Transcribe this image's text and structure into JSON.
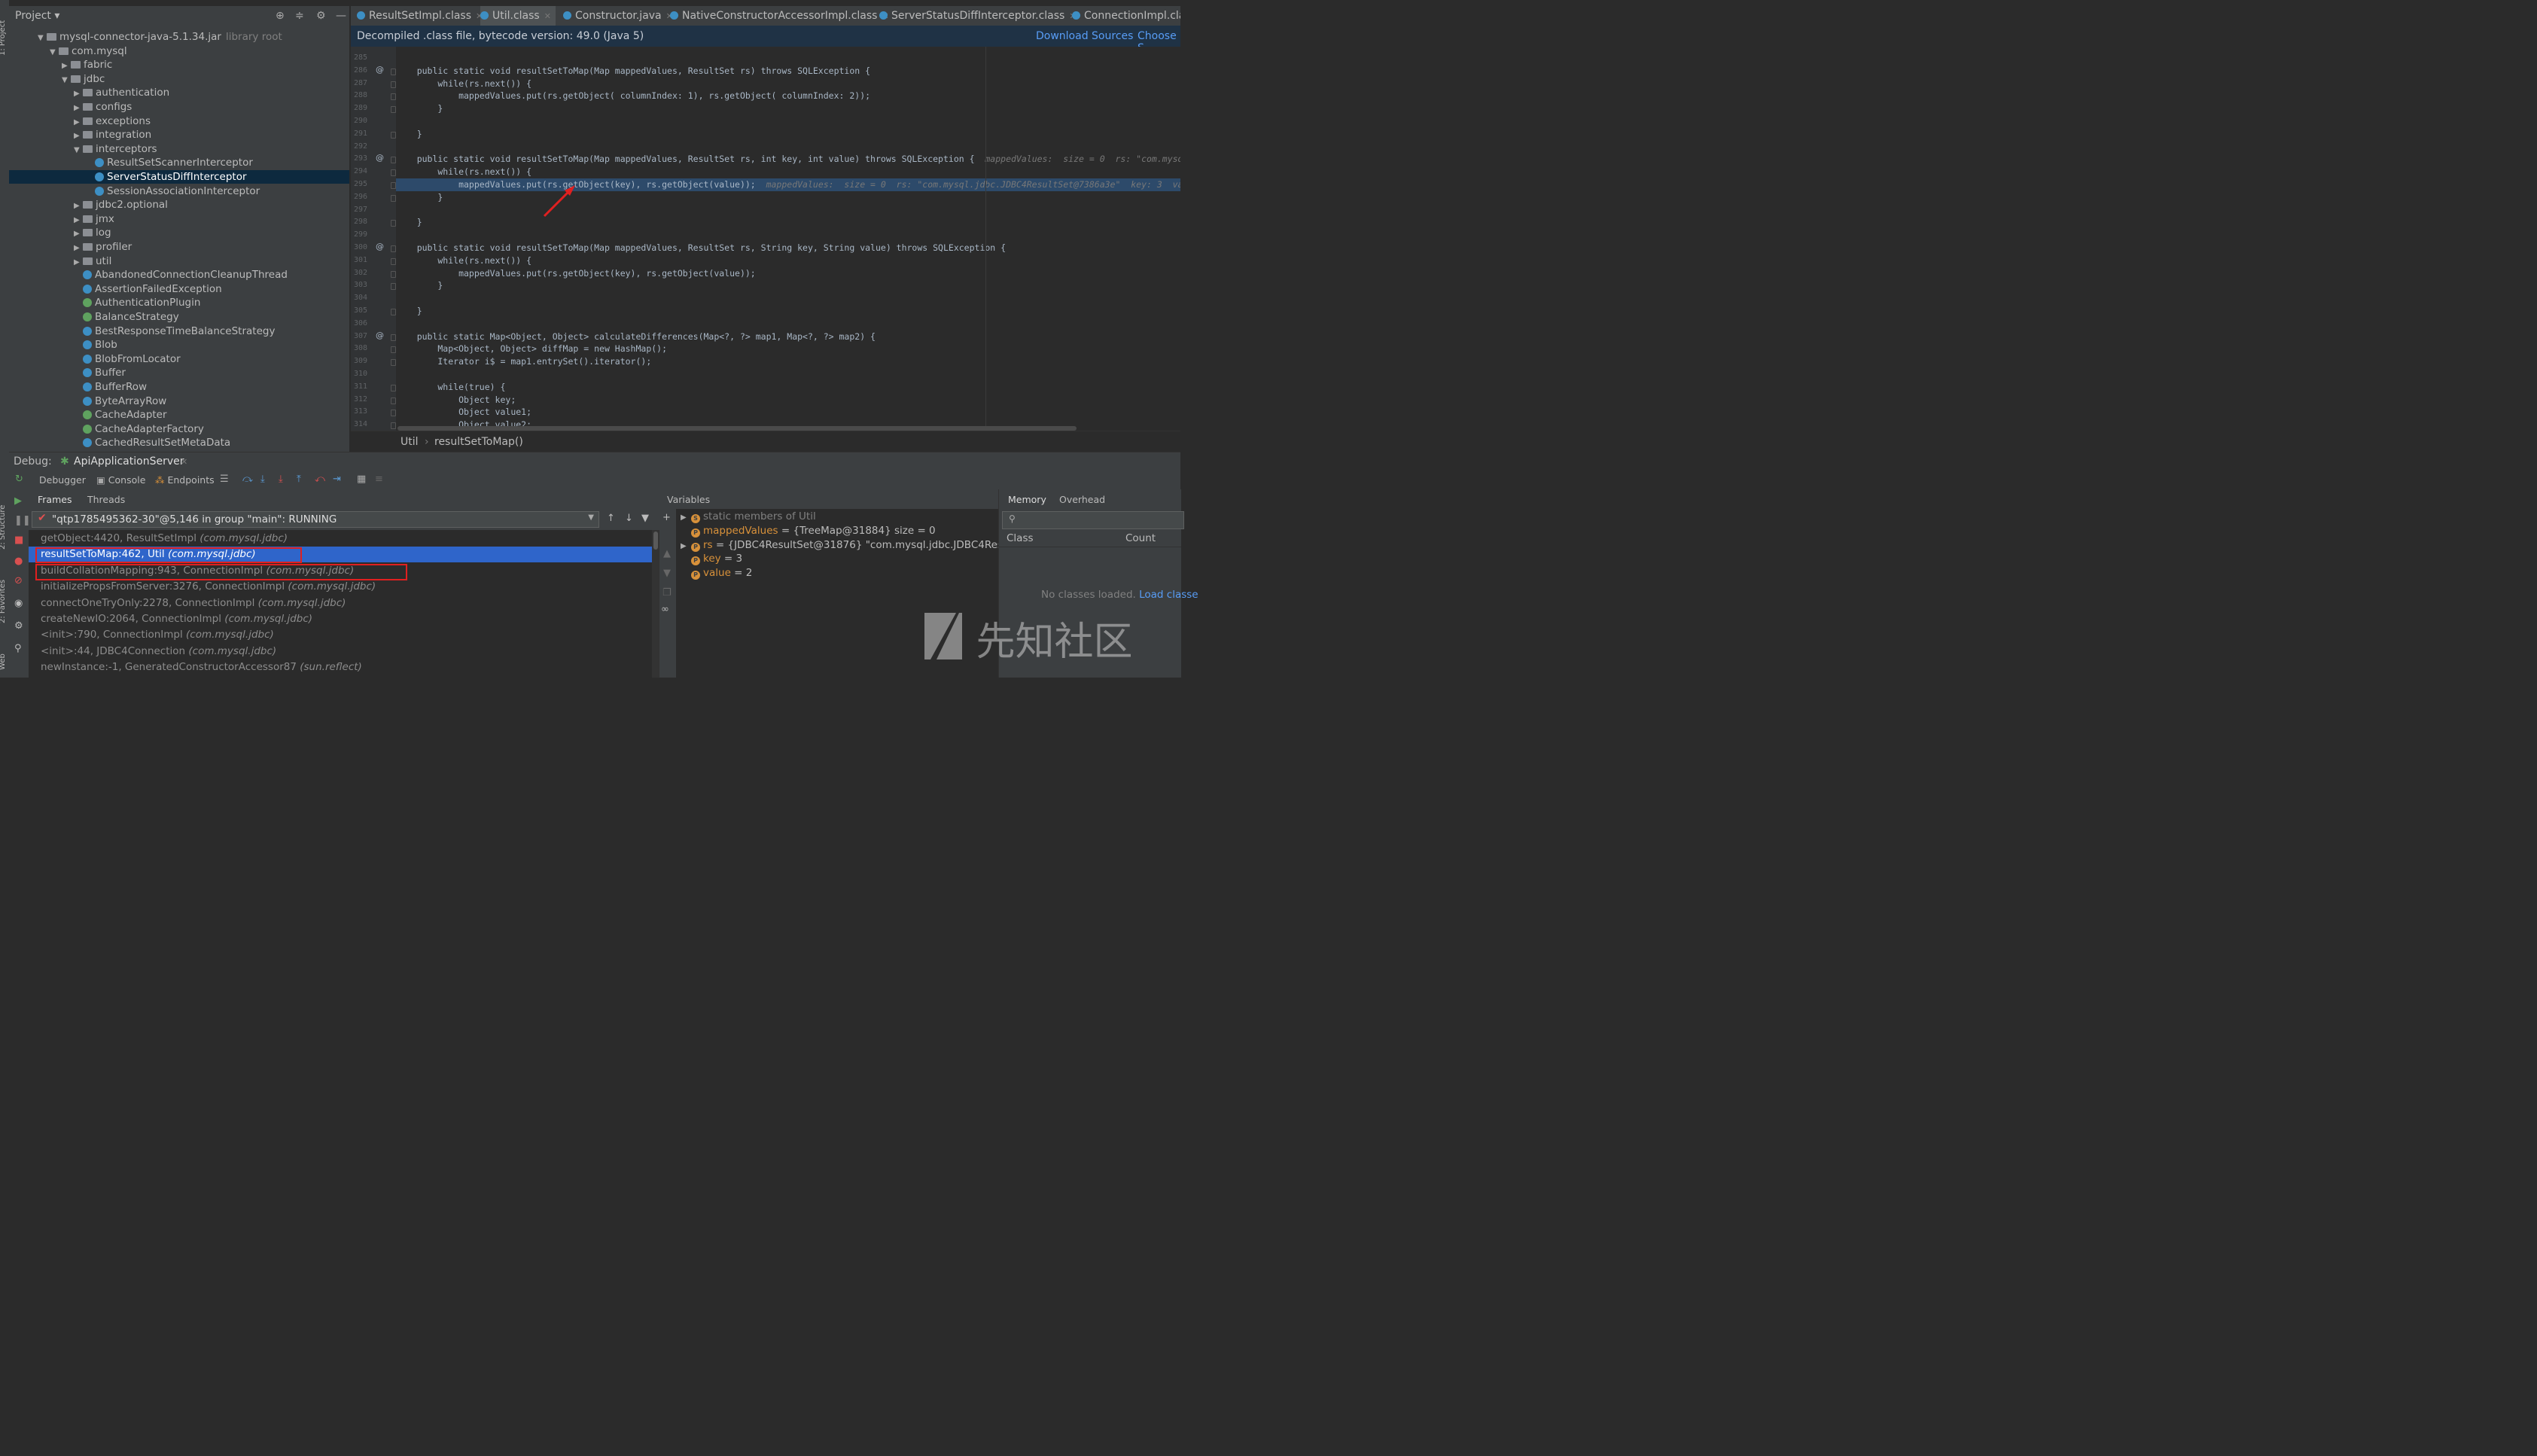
{
  "project_panel": {
    "title": "Project",
    "tree": [
      {
        "label": "mysql-connector-java-5.1.34.jar",
        "note": "library root",
        "indent": 3,
        "kind": "jar",
        "arrow": "▼"
      },
      {
        "label": "com.mysql",
        "indent": 4,
        "kind": "folder",
        "arrow": "▼"
      },
      {
        "label": "fabric",
        "indent": 5,
        "kind": "folder",
        "arrow": "▶"
      },
      {
        "label": "jdbc",
        "indent": 5,
        "kind": "folder",
        "arrow": "▼"
      },
      {
        "label": "authentication",
        "indent": 6,
        "kind": "folder",
        "arrow": "▶"
      },
      {
        "label": "configs",
        "indent": 6,
        "kind": "folder",
        "arrow": "▶"
      },
      {
        "label": "exceptions",
        "indent": 6,
        "kind": "folder",
        "arrow": "▶"
      },
      {
        "label": "integration",
        "indent": 6,
        "kind": "folder",
        "arrow": "▶"
      },
      {
        "label": "interceptors",
        "indent": 6,
        "kind": "folder",
        "arrow": "▼"
      },
      {
        "label": "ResultSetScannerInterceptor",
        "indent": 7,
        "kind": "class"
      },
      {
        "label": "ServerStatusDiffInterceptor",
        "indent": 7,
        "kind": "class",
        "selected": true
      },
      {
        "label": "SessionAssociationInterceptor",
        "indent": 7,
        "kind": "class"
      },
      {
        "label": "jdbc2.optional",
        "indent": 6,
        "kind": "folder",
        "arrow": "▶"
      },
      {
        "label": "jmx",
        "indent": 6,
        "kind": "folder",
        "arrow": "▶"
      },
      {
        "label": "log",
        "indent": 6,
        "kind": "folder",
        "arrow": "▶"
      },
      {
        "label": "profiler",
        "indent": 6,
        "kind": "folder",
        "arrow": "▶"
      },
      {
        "label": "util",
        "indent": 6,
        "kind": "folder",
        "arrow": "▶"
      },
      {
        "label": "AbandonedConnectionCleanupThread",
        "indent": 6,
        "kind": "class"
      },
      {
        "label": "AssertionFailedException",
        "indent": 6,
        "kind": "class"
      },
      {
        "label": "AuthenticationPlugin",
        "indent": 6,
        "kind": "class-green"
      },
      {
        "label": "BalanceStrategy",
        "indent": 6,
        "kind": "class-green"
      },
      {
        "label": "BestResponseTimeBalanceStrategy",
        "indent": 6,
        "kind": "class"
      },
      {
        "label": "Blob",
        "indent": 6,
        "kind": "class"
      },
      {
        "label": "BlobFromLocator",
        "indent": 6,
        "kind": "class"
      },
      {
        "label": "Buffer",
        "indent": 6,
        "kind": "class"
      },
      {
        "label": "BufferRow",
        "indent": 6,
        "kind": "class"
      },
      {
        "label": "ByteArrayRow",
        "indent": 6,
        "kind": "class"
      },
      {
        "label": "CacheAdapter",
        "indent": 6,
        "kind": "class-green"
      },
      {
        "label": "CacheAdapterFactory",
        "indent": 6,
        "kind": "class-green"
      },
      {
        "label": "CachedResultSetMetaData",
        "indent": 6,
        "kind": "class"
      }
    ]
  },
  "editor": {
    "tabs": [
      "ResultSetImpl.class",
      "Util.class",
      "Constructor.java",
      "NativeConstructorAccessorImpl.class",
      "ServerStatusDiffInterceptor.class",
      "ConnectionImpl.cla"
    ],
    "active_tab": "Util.class",
    "info_message": "Decompiled .class file, bytecode version: 49.0 (Java 5)",
    "download_sources": "Download Sources",
    "choose_sources": "Choose S",
    "lines": [
      {
        "n": "285",
        "code": "",
        "at": false
      },
      {
        "n": "286",
        "code": "    public static void resultSetToMap(Map mappedValues, ResultSet rs) throws SQLException {",
        "at": true
      },
      {
        "n": "287",
        "code": "        while(rs.next()) {",
        "at": false
      },
      {
        "n": "288",
        "code": "            mappedValues.put(rs.getObject( columnIndex: 1), rs.getObject( columnIndex: 2));",
        "at": false
      },
      {
        "n": "289",
        "code": "        }",
        "at": false
      },
      {
        "n": "290",
        "code": "",
        "at": false
      },
      {
        "n": "291",
        "code": "    }",
        "at": false
      },
      {
        "n": "292",
        "code": "",
        "at": false
      },
      {
        "n": "293",
        "code": "    public static void resultSetToMap(Map mappedValues, ResultSet rs, int key, int value) throws SQLException {",
        "hint": "  mappedValues:  size = 0  rs: \"com.mysql.jdbc.JD",
        "at": true
      },
      {
        "n": "294",
        "code": "        while(rs.next()) {",
        "at": false
      },
      {
        "n": "295",
        "code": "            mappedValues.put(rs.getObject(key), rs.getObject(value));",
        "hint": "  mappedValues:  size = 0  rs: \"com.mysql.jdbc.JDBC4ResultSet@7386a3e\"  key: 3  value: 2",
        "at": false,
        "highlight": true
      },
      {
        "n": "296",
        "code": "        }",
        "at": false
      },
      {
        "n": "297",
        "code": "",
        "at": false
      },
      {
        "n": "298",
        "code": "    }",
        "at": false
      },
      {
        "n": "299",
        "code": "",
        "at": false
      },
      {
        "n": "300",
        "code": "    public static void resultSetToMap(Map mappedValues, ResultSet rs, String key, String value) throws SQLException {",
        "at": true
      },
      {
        "n": "301",
        "code": "        while(rs.next()) {",
        "at": false
      },
      {
        "n": "302",
        "code": "            mappedValues.put(rs.getObject(key), rs.getObject(value));",
        "at": false
      },
      {
        "n": "303",
        "code": "        }",
        "at": false
      },
      {
        "n": "304",
        "code": "",
        "at": false
      },
      {
        "n": "305",
        "code": "    }",
        "at": false
      },
      {
        "n": "306",
        "code": "",
        "at": false
      },
      {
        "n": "307",
        "code": "    public static Map<Object, Object> calculateDifferences(Map<?, ?> map1, Map<?, ?> map2) {",
        "at": true
      },
      {
        "n": "308",
        "code": "        Map<Object, Object> diffMap = new HashMap();",
        "at": false
      },
      {
        "n": "309",
        "code": "        Iterator i$ = map1.entrySet().iterator();",
        "at": false
      },
      {
        "n": "310",
        "code": "",
        "at": false
      },
      {
        "n": "311",
        "code": "        while(true) {",
        "at": false
      },
      {
        "n": "312",
        "code": "            Object key;",
        "at": false
      },
      {
        "n": "313",
        "code": "            Object value1;",
        "at": false
      },
      {
        "n": "314",
        "code": "            Object value2;",
        "at": false
      }
    ],
    "breadcrumb": [
      "Util",
      "resultSetToMap()"
    ]
  },
  "debug": {
    "label": "Debug:",
    "config": "ApiApplicationServer",
    "tabs": [
      "Debugger",
      "Console",
      "Endpoints"
    ],
    "frames_tabs": [
      "Frames",
      "Threads"
    ],
    "thread": "\"qtp1785495362-30\"@5,146 in group \"main\": RUNNING",
    "frames": [
      {
        "method": "getObject:4420, ResultSetImpl",
        "pkg": "(com.mysql.jdbc)"
      },
      {
        "method": "resultSetToMap:462, Util",
        "pkg": "(com.mysql.jdbc)",
        "selected": true
      },
      {
        "method": "buildCollationMapping:943, ConnectionImpl",
        "pkg": "(com.mysql.jdbc)"
      },
      {
        "method": "initializePropsFromServer:3276, ConnectionImpl",
        "pkg": "(com.mysql.jdbc)"
      },
      {
        "method": "connectOneTryOnly:2278, ConnectionImpl",
        "pkg": "(com.mysql.jdbc)"
      },
      {
        "method": "createNewIO:2064, ConnectionImpl",
        "pkg": "(com.mysql.jdbc)"
      },
      {
        "method": "<init>:790, ConnectionImpl",
        "pkg": "(com.mysql.jdbc)"
      },
      {
        "method": "<init>:44, JDBC4Connection",
        "pkg": "(com.mysql.jdbc)"
      },
      {
        "method": "newInstance:-1, GeneratedConstructorAccessor87",
        "pkg": "(sun.reflect)"
      }
    ],
    "variables_title": "Variables",
    "variables": [
      {
        "name": "static members of Util",
        "value": "",
        "badge": "S",
        "arrow": "▶"
      },
      {
        "name": "mappedValues",
        "value": " = {TreeMap@31884}  size = 0",
        "badge": "P"
      },
      {
        "name": "rs",
        "value": " = {JDBC4ResultSet@31876} \"com.mysql.jdbc.JDBC4Result",
        "badge": "P",
        "arrow": "▶"
      },
      {
        "name": "key",
        "value": " = 3",
        "badge": "P"
      },
      {
        "name": "value",
        "value": " = 2",
        "badge": "P"
      }
    ],
    "memory_tabs": [
      "Memory",
      "Overhead"
    ],
    "memory_columns": [
      "Class",
      "Count"
    ],
    "memory_empty": "No classes loaded.",
    "memory_load": "Load classe"
  },
  "side_labels": [
    "1: Project",
    "2: Structure",
    "2: Favorites",
    "Web"
  ],
  "watermark": "先知社区",
  "colors": {
    "accent": "#2f65ca",
    "highlight_box": "#e02020",
    "link": "#589df6"
  }
}
